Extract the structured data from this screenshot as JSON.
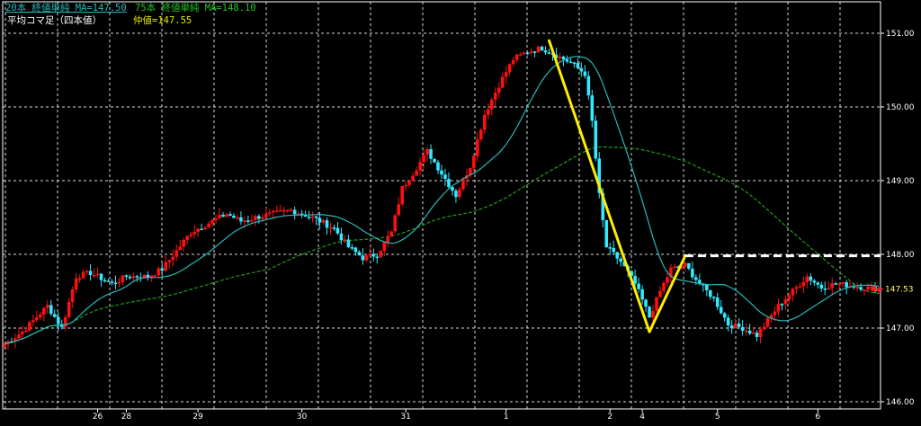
{
  "colors": {
    "background": "#000000",
    "grid": "#ffffff",
    "up_candle": "#ff1010",
    "down_candle": "#33e8ff",
    "ma20": "#2ab8b8",
    "ma75": "#1f9a1f",
    "trend_line": "#ffee00",
    "resistance_line": "#ffffff",
    "price_tag": "#ff2020",
    "axis_text": "#ffffff"
  },
  "legend": {
    "ma20_label": "20本 終値単純 MA=147.50",
    "ma75_label": "75本 終値単純 MA=148.10",
    "heikin_label": "平均コマ足（四本値）",
    "mid_label": "仲値=147.55"
  },
  "last_price_label": "147.53",
  "chart_data": {
    "type": "candlestick",
    "ylim": [
      146.0,
      151.2
    ],
    "y_ticks": [
      "151.00",
      "150.00",
      "149.00",
      "148.00",
      "147.00",
      "146.00"
    ],
    "x_ticks": [
      "26",
      "28",
      "29",
      "30",
      "31",
      "1",
      "2",
      "4",
      "5",
      "6"
    ],
    "x_tick_index": [
      26,
      34,
      54,
      83,
      112,
      140,
      169,
      178,
      199,
      227
    ],
    "n_bars": 245,
    "close_anchors": [
      [
        0,
        146.78
      ],
      [
        5,
        146.95
      ],
      [
        12,
        147.3
      ],
      [
        16,
        147.0
      ],
      [
        20,
        147.7
      ],
      [
        24,
        147.75
      ],
      [
        28,
        147.65
      ],
      [
        30,
        147.6
      ],
      [
        34,
        147.7
      ],
      [
        40,
        147.7
      ],
      [
        44,
        147.8
      ],
      [
        48,
        148.05
      ],
      [
        52,
        148.3
      ],
      [
        58,
        148.45
      ],
      [
        62,
        148.55
      ],
      [
        66,
        148.45
      ],
      [
        70,
        148.5
      ],
      [
        75,
        148.55
      ],
      [
        80,
        148.6
      ],
      [
        86,
        148.5
      ],
      [
        92,
        148.35
      ],
      [
        96,
        148.1
      ],
      [
        100,
        147.95
      ],
      [
        104,
        148.0
      ],
      [
        108,
        148.3
      ],
      [
        111,
        148.9
      ],
      [
        114,
        149.1
      ],
      [
        118,
        149.4
      ],
      [
        122,
        149.1
      ],
      [
        126,
        148.8
      ],
      [
        130,
        149.2
      ],
      [
        134,
        149.9
      ],
      [
        138,
        150.3
      ],
      [
        142,
        150.65
      ],
      [
        146,
        150.75
      ],
      [
        150,
        150.8
      ],
      [
        154,
        150.7
      ],
      [
        158,
        150.6
      ],
      [
        162,
        150.45
      ],
      [
        164,
        149.8
      ],
      [
        166,
        148.8
      ],
      [
        168,
        148.1
      ],
      [
        172,
        147.9
      ],
      [
        176,
        147.6
      ],
      [
        180,
        147.15
      ],
      [
        183,
        147.5
      ],
      [
        186,
        147.8
      ],
      [
        190,
        147.85
      ],
      [
        194,
        147.6
      ],
      [
        198,
        147.4
      ],
      [
        202,
        147.05
      ],
      [
        206,
        147.0
      ],
      [
        208,
        146.95
      ],
      [
        210,
        146.9
      ],
      [
        213,
        147.1
      ],
      [
        216,
        147.3
      ],
      [
        220,
        147.5
      ],
      [
        224,
        147.7
      ],
      [
        228,
        147.55
      ],
      [
        232,
        147.6
      ],
      [
        236,
        147.58
      ],
      [
        240,
        147.55
      ],
      [
        244,
        147.53
      ]
    ],
    "series": [
      {
        "name": "20本 終値単純 MA",
        "last": 147.5
      },
      {
        "name": "75本 終値単純 MA",
        "last": 148.1
      }
    ],
    "trend_lines": [
      {
        "kind": "trend",
        "from": {
          "bar": 152,
          "price": 150.9
        },
        "to": {
          "bar": 180,
          "price": 146.95
        }
      },
      {
        "kind": "trend",
        "from": {
          "bar": 180,
          "price": 146.95
        },
        "to": {
          "bar": 190,
          "price": 147.98
        }
      }
    ],
    "resistance_line": {
      "from_bar": 190,
      "to_bar": 245,
      "price": 147.98
    },
    "last_price": 147.53
  }
}
